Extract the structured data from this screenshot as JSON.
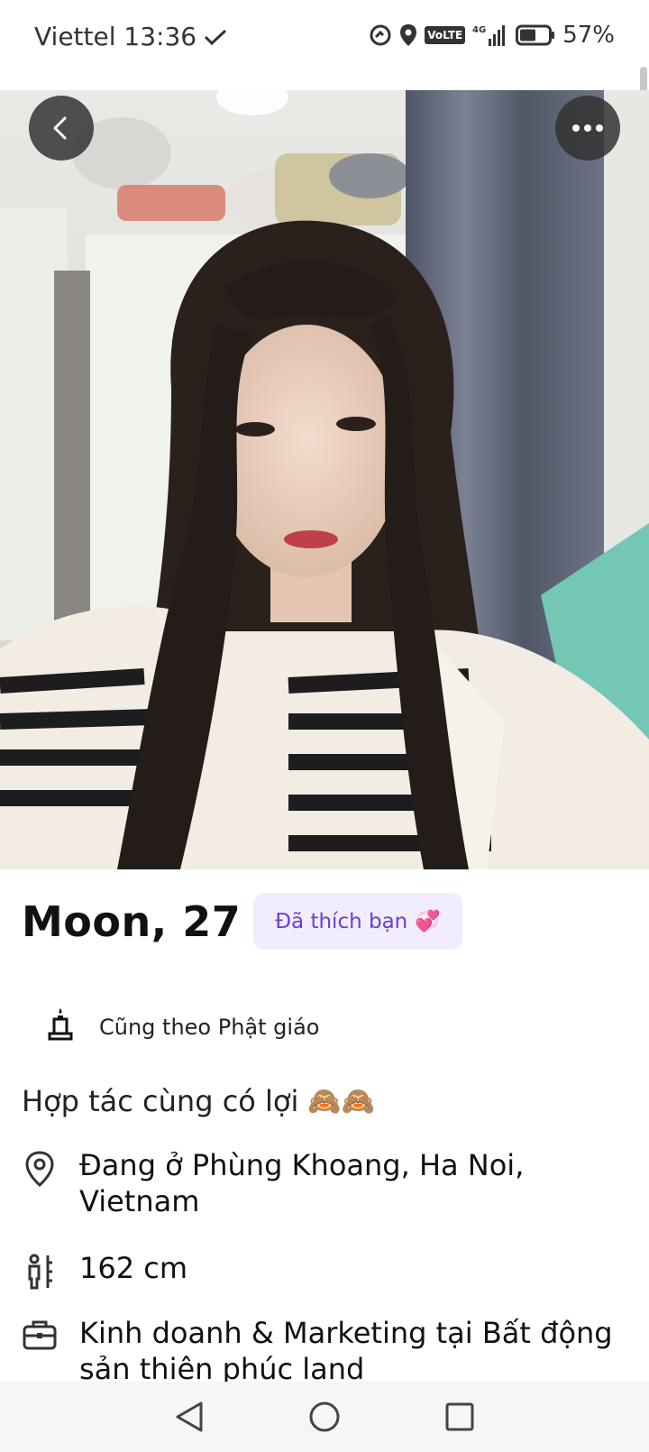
{
  "status_bar": {
    "carrier_time": "Viettel 13:36",
    "battery": "57%",
    "icons": [
      "check-icon",
      "data-saver-icon",
      "location-icon",
      "volte-icon",
      "signal-4g-icon",
      "battery-icon"
    ],
    "volte_label": "VoLTE",
    "network": "4G"
  },
  "profile": {
    "name_age": "Moon, 27",
    "liked_badge": "Đã thích bạn",
    "liked_emoji": "💞",
    "religion": "Cũng theo Phật giáo",
    "bio": "Hợp tác cùng có lợi",
    "bio_emoji": "🙈🙈",
    "location": "Đang ở Phùng Khoang, Ha Noi, Vietnam",
    "height": "162 cm",
    "job": "Kinh doanh & Marketing tại Bất động sản thiên phúc land"
  },
  "colors": {
    "accent": "#6a3fd0",
    "badge_bg": "#f2ecff",
    "button_bg": "#323232"
  }
}
